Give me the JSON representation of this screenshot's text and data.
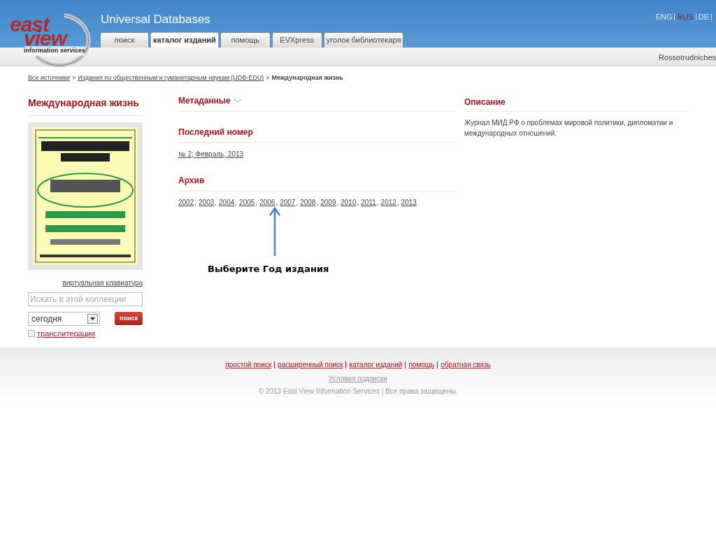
{
  "logo": {
    "line_1": "east",
    "line_2": "view",
    "tagline": "information services"
  },
  "site_title": "Universal Databases",
  "tabs": [
    {
      "label": "поиск",
      "selected": false
    },
    {
      "label": "каталог изданий",
      "selected": true
    },
    {
      "label": "помощь",
      "selected": false
    },
    {
      "label": "EVXpress",
      "selected": false
    },
    {
      "label": "уголок библиотекаря",
      "selected": false
    }
  ],
  "languages": [
    {
      "label": "ENG",
      "selected": false
    },
    {
      "label": "RUS",
      "selected": true
    },
    {
      "label": "DE",
      "selected": false
    }
  ],
  "user": "Rossotrudniches",
  "breadcrumb_separator": ">",
  "breadcrumb": [
    {
      "label": "Все источники",
      "link": true
    },
    {
      "label": "Издания по общественным и гуманитарным наукам (UDB-EDU)",
      "link": true
    },
    {
      "label": "Международная жизнь",
      "link": false
    }
  ],
  "left": {
    "title": "Международная жизнь",
    "keyboard_link": "виртуальная клавиатура",
    "search": {
      "placeholder": "Искать в этой коллекции"
    },
    "period": "сегодня",
    "search_button": "поиск",
    "translit": {
      "label": "транслитерация",
      "checked": false
    }
  },
  "middle": {
    "metadata": {
      "label": "Метаданные",
      "expanded": false
    },
    "latest": {
      "title": "Последний номер",
      "issue": "№ 2; Февраль, 2013"
    },
    "archive": {
      "title": "Архив",
      "separator": ",",
      "years": [
        "2002",
        "2003",
        "2004",
        "2005",
        "2006",
        "2007",
        "2008",
        "2009",
        "2010",
        "2011",
        "2012",
        "2013"
      ]
    }
  },
  "right": {
    "title": "Описание",
    "text": "Журнал МИД РФ о проблемах мировой политики, дипломатии и международных отношений."
  },
  "annotation": "Выберите Год издания",
  "footer": {
    "links": [
      "простой поиск",
      "расширенный поиск",
      "каталог изданий",
      "помощь",
      "обратная связь"
    ],
    "terms": "Условия подписки",
    "copyright": "© 2013 East View Information Services | Все права защищены."
  }
}
